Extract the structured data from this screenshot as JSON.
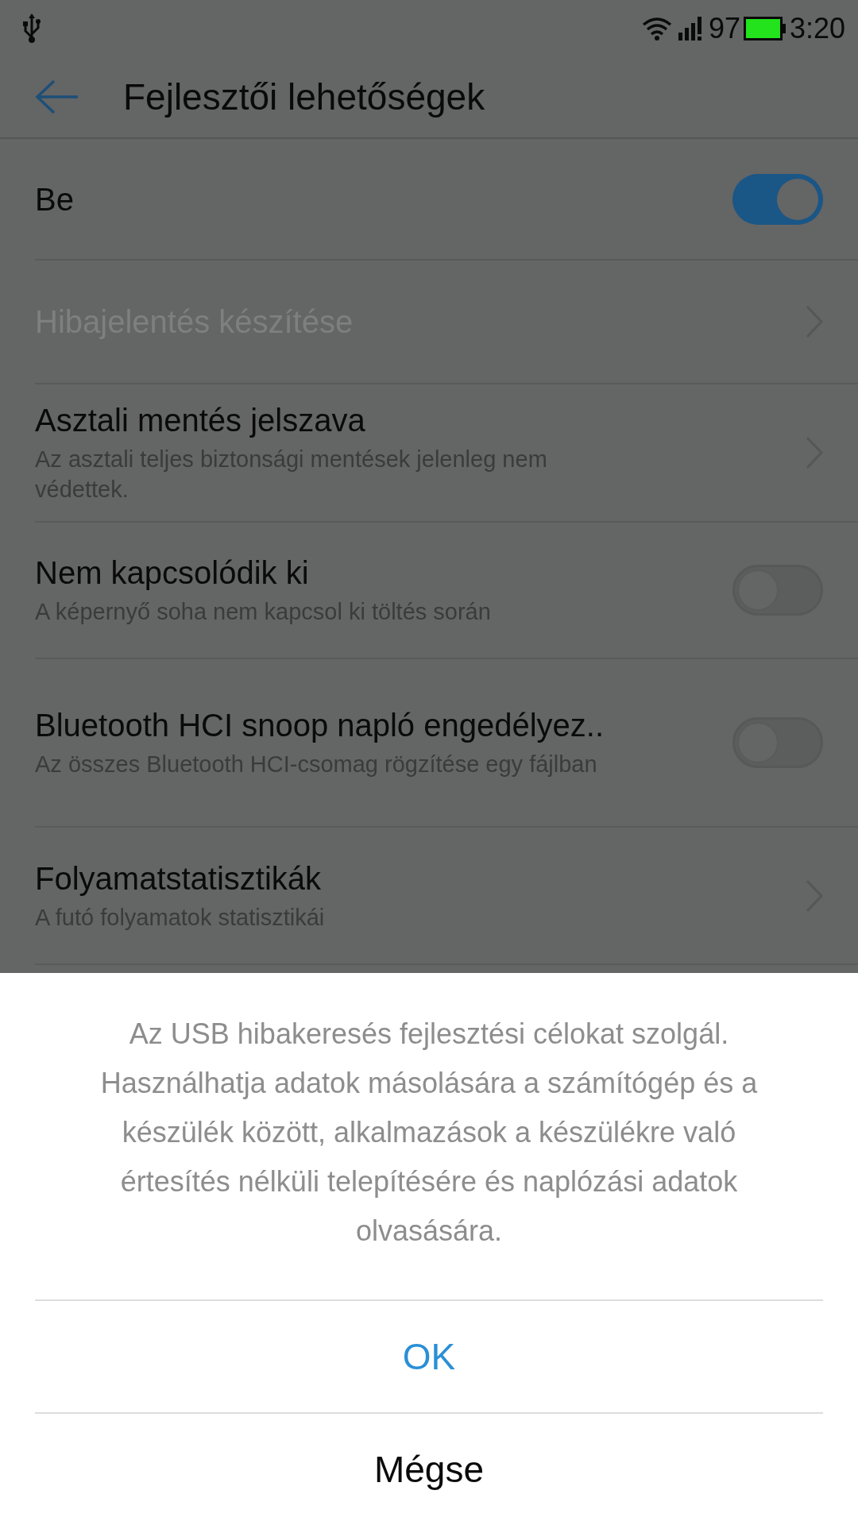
{
  "status_bar": {
    "battery_percent": "97",
    "time": "3:20"
  },
  "header": {
    "title": "Fejlesztői lehetőségek"
  },
  "settings": [
    {
      "kind": "toggle",
      "title": "Be",
      "disabled": false,
      "toggle": {
        "on": true
      }
    },
    {
      "kind": "link",
      "title": "Hibajelentés készítése",
      "disabled": true
    },
    {
      "kind": "link",
      "title": "Asztali mentés jelszava",
      "subtitle": "Az asztali teljes biztonsági mentések jelenleg nem védettek.",
      "disabled": false
    },
    {
      "kind": "toggle",
      "title": "Nem kapcsolódik ki",
      "subtitle": "A képernyő soha nem kapcsol ki töltés során",
      "disabled": false,
      "toggle": {
        "on": false
      }
    },
    {
      "kind": "toggle",
      "title": "Bluetooth HCI snoop napló engedélyez..",
      "subtitle": "Az összes Bluetooth HCI-csomag rögzítése egy fájlban",
      "disabled": false,
      "toggle": {
        "on": false
      }
    },
    {
      "kind": "link",
      "title": "Folyamatstatisztikák",
      "subtitle": "A futó folyamatok statisztikái",
      "disabled": false
    }
  ],
  "dialog": {
    "message": "Az USB hibakeresés fejlesztési célokat szolgál. Használhatja adatok másolására a számítógép és a készülék között, alkalmazások a készülékre való értesítés nélküli telepítésére és naplózási adatok olvasására.",
    "buttons": [
      {
        "label": "OK",
        "kind": "primary"
      },
      {
        "label": "Mégse",
        "kind": "default"
      }
    ]
  }
}
